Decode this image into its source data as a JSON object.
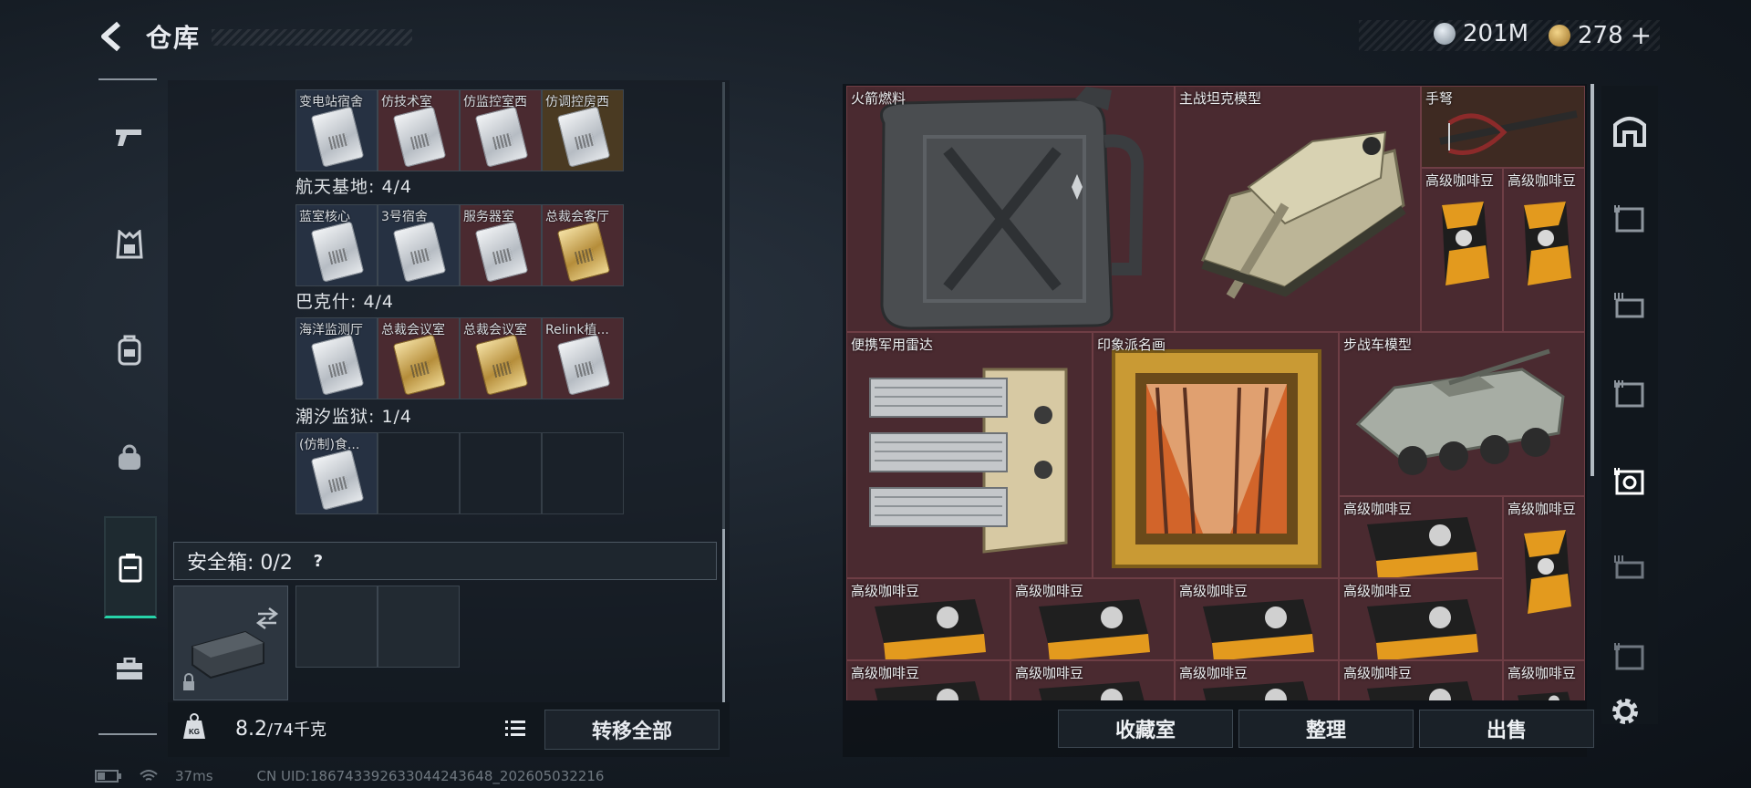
{
  "header": {
    "title": "仓库",
    "currency_silver": "201M",
    "currency_gold": "278",
    "add_label": "+"
  },
  "left_nav": {
    "items": [
      "weapon-icon",
      "armor-icon",
      "backpack-icon",
      "bag-icon",
      "case-icon",
      "toolbox-icon"
    ],
    "active_index": 4
  },
  "collection_groups": [
    {
      "title": "",
      "cells": [
        {
          "label": "变电站宿舍",
          "tone": "blue",
          "card": "silver"
        },
        {
          "label": "仿技术室",
          "tone": "red",
          "card": "silver"
        },
        {
          "label": "仿监控室西",
          "tone": "red",
          "card": "silver"
        },
        {
          "label": "仿调控房西",
          "tone": "gold",
          "card": "silver"
        }
      ]
    },
    {
      "title": "航天基地: 4/4",
      "cells": [
        {
          "label": "蓝室核心",
          "tone": "blue",
          "card": "silver"
        },
        {
          "label": "3号宿舍",
          "tone": "blue",
          "card": "silver"
        },
        {
          "label": "服务器室",
          "tone": "red",
          "card": "silver"
        },
        {
          "label": "总裁会客厅",
          "tone": "red",
          "card": "gold"
        }
      ]
    },
    {
      "title": "巴克什: 4/4",
      "cells": [
        {
          "label": "海洋监测厅",
          "tone": "blue",
          "card": "silver"
        },
        {
          "label": "总裁会议室",
          "tone": "red",
          "card": "gold"
        },
        {
          "label": "总裁会议室",
          "tone": "red",
          "card": "gold"
        },
        {
          "label": "Relink植...",
          "tone": "red",
          "card": "silver"
        }
      ]
    },
    {
      "title": "潮汐监狱: 1/4",
      "cells": [
        {
          "label": "(仿制)食...",
          "tone": "blue",
          "card": "silver"
        },
        {
          "label": "",
          "tone": "empty",
          "card": ""
        },
        {
          "label": "",
          "tone": "empty",
          "card": ""
        },
        {
          "label": "",
          "tone": "empty",
          "card": ""
        }
      ]
    }
  ],
  "safe_box": {
    "label": "安全箱: 0/2",
    "help": "?"
  },
  "weight": {
    "current": "8.2",
    "max": "/74千克",
    "icon_label": "KG"
  },
  "transfer_all_label": "转移全部",
  "stash_items": {
    "rocket_fuel": "火箭燃料",
    "tank_model": "主战坦克模型",
    "crossbow": "手弩",
    "coffee": "高级咖啡豆",
    "radar": "便携军用雷达",
    "painting": "印象派名画",
    "ifv_model": "步战车模型"
  },
  "bottom_buttons": {
    "collection": "收藏室",
    "sort": "整理",
    "sell": "出售"
  },
  "status": {
    "ping": "37ms",
    "uid": "CN UID:186743392633044243648_202605032216"
  },
  "colors": {
    "accent": "#27d3a8",
    "stash_cell": "#4a2a30"
  }
}
